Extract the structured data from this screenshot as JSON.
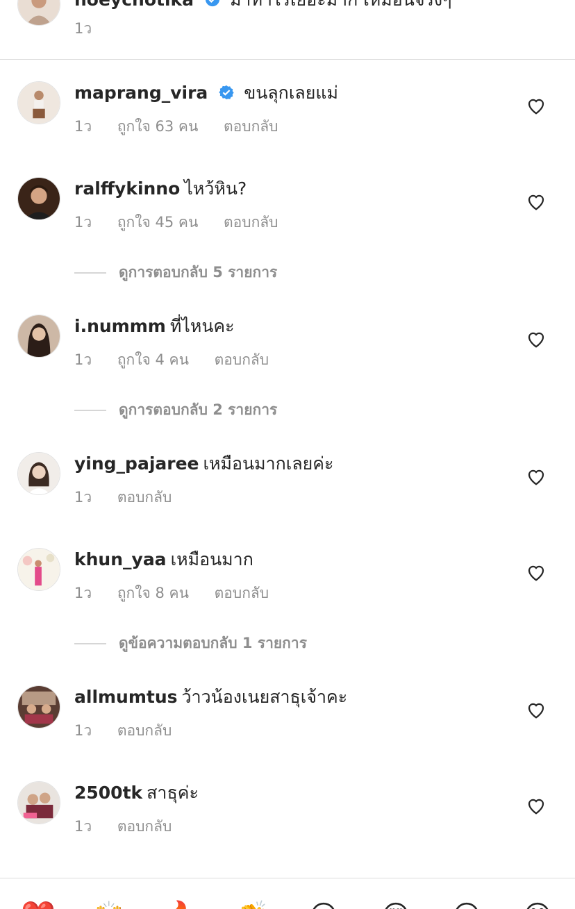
{
  "top_comment": {
    "username": "noeychotika",
    "text": "มาทำไรเยอะมาก เหมือนจริงๆ",
    "time": "1ว"
  },
  "comments": [
    {
      "username": "maprang_vira",
      "verified": true,
      "text": "ขนลุกเลยแม่",
      "time": "1ว",
      "likes": "ถูกใจ 63 คน",
      "reply": "ตอบกลับ",
      "avatar": "avatar-maprang"
    },
    {
      "username": "ralffykinno",
      "verified": false,
      "text": "ไหว้หิน?",
      "time": "1ว",
      "likes": "ถูกใจ 45 คน",
      "reply": "ตอบกลับ",
      "view_replies": "ดูการตอบกลับ 5 รายการ"
    },
    {
      "username": "i.nummm",
      "verified": false,
      "text": "ที่ไหนคะ",
      "time": "1ว",
      "likes": "ถูกใจ 4 คน",
      "reply": "ตอบกลับ",
      "view_replies": "ดูการตอบกลับ 2 รายการ"
    },
    {
      "username": "ying_pajaree",
      "verified": false,
      "text": "เหมือนมากเลยค่ะ",
      "time": "1ว",
      "likes": "",
      "reply": "ตอบกลับ"
    },
    {
      "username": "khun_yaa",
      "verified": false,
      "text": "เหมือนมาก",
      "time": "1ว",
      "likes": "ถูกใจ 8 คน",
      "reply": "ตอบกลับ",
      "view_replies": "ดูข้อความตอบกลับ 1 รายการ"
    },
    {
      "username": "allmumtus",
      "verified": false,
      "text": "ว้าวน้องเนยสาธุเจ้าคะ",
      "time": "1ว",
      "likes": "",
      "reply": "ตอบกลับ"
    },
    {
      "username": "2500tk",
      "verified": false,
      "text": "สาธุค่ะ",
      "time": "1ว",
      "likes": "",
      "reply": "ตอบกลับ"
    }
  ],
  "emoji_bar": [
    "❤️",
    "🙌",
    "🔥",
    "👏",
    "😢",
    "😍",
    "😮",
    "😂"
  ],
  "colors": {
    "verified_blue": "#3897f0",
    "text_primary": "#262626",
    "text_secondary": "#8e8e8e",
    "separator": "#dbdbdb"
  }
}
